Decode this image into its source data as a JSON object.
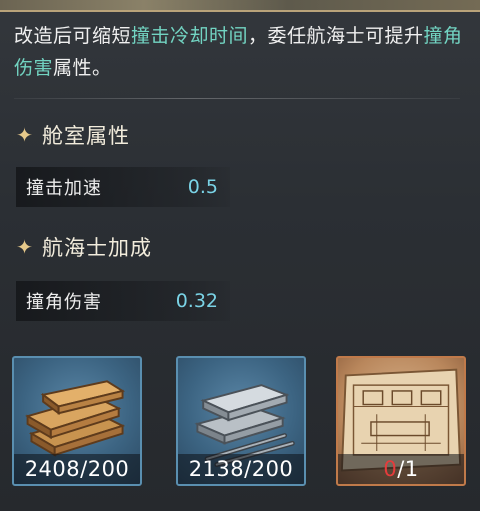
{
  "description": {
    "part1": "改造后可缩短",
    "highlight1": "撞击冷却时间",
    "part2": "，委任航海士可提升",
    "highlight2": "撞角伤害",
    "part3": "属性。"
  },
  "cabin_section": {
    "title": "舱室属性",
    "stats": [
      {
        "name": "撞击加速",
        "value": "0.5"
      }
    ]
  },
  "navigator_section": {
    "title": "航海士加成",
    "stats": [
      {
        "name": "撞角伤害",
        "value": "0.32"
      }
    ]
  },
  "materials": [
    {
      "icon": "wood-planks-icon",
      "count": "2408/200"
    },
    {
      "icon": "iron-plates-icon",
      "count": "2138/200"
    },
    {
      "icon": "blueprint-icon",
      "count_have": "0",
      "count_need": "/1"
    }
  ],
  "colors": {
    "highlight": "#72d4c2",
    "value": "#7ad3e6",
    "title_star": "#e6c98a",
    "insufficient": "#e43c3c",
    "rare_border": "#5a8fb0",
    "epic_border": "#c07a4a"
  }
}
